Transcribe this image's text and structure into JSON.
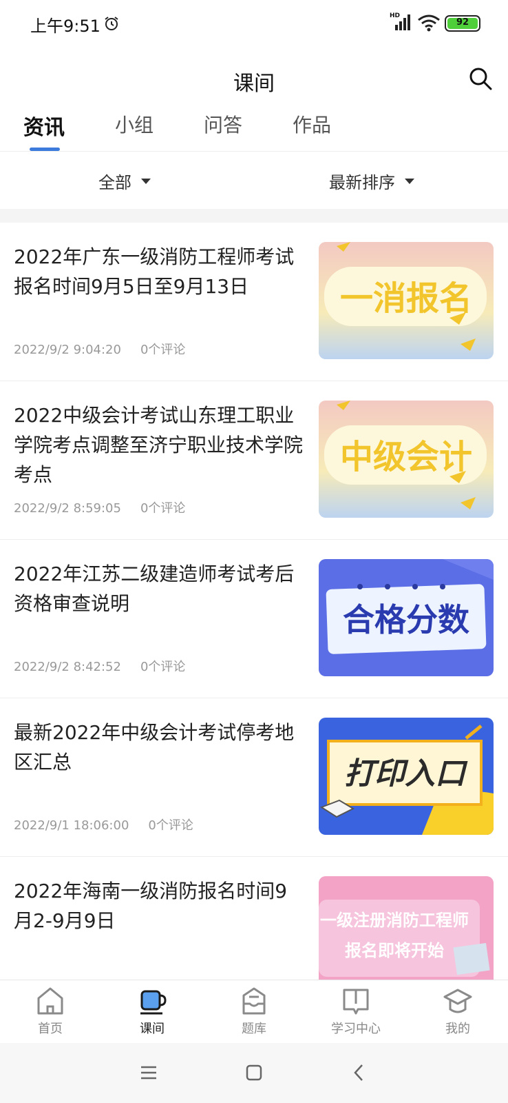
{
  "status_bar": {
    "time": "上午9:51",
    "network": "HD",
    "battery": "92"
  },
  "header": {
    "title": "课间"
  },
  "tabs": [
    {
      "label": "资讯",
      "active": true
    },
    {
      "label": "小组",
      "active": false
    },
    {
      "label": "问答",
      "active": false
    },
    {
      "label": "作品",
      "active": false
    }
  ],
  "filters": {
    "category": "全部",
    "sort": "最新排序"
  },
  "articles": [
    {
      "title": "2022年广东一级消防工程师考试报名时间9月5日至9月13日",
      "date": "2022/9/2 9:04:20",
      "comments": "0个评论",
      "thumb_text": "一消报名"
    },
    {
      "title": "2022中级会计考试山东理工职业学院考点调整至济宁职业技术学院考点",
      "date": "2022/9/2 8:59:05",
      "comments": "0个评论",
      "thumb_text": "中级会计"
    },
    {
      "title": "2022年江苏二级建造师考试考后资格审查说明",
      "date": "2022/9/2 8:42:52",
      "comments": "0个评论",
      "thumb_text": "合格分数"
    },
    {
      "title": "最新2022年中级会计考试停考地区汇总",
      "date": "2022/9/1 18:06:00",
      "comments": "0个评论",
      "thumb_text": "打印入口"
    },
    {
      "title": "2022年海南一级消防报名时间9月2-9月9日",
      "date": "",
      "comments": "",
      "thumb_text_line1": "一级注册消防工程师",
      "thumb_text_line2": "报名即将开始"
    }
  ],
  "bottom_nav": [
    {
      "label": "首页",
      "icon": "home-icon"
    },
    {
      "label": "课间",
      "icon": "cup-icon",
      "active": true
    },
    {
      "label": "题库",
      "icon": "inbox-icon"
    },
    {
      "label": "学习中心",
      "icon": "book-icon"
    },
    {
      "label": "我的",
      "icon": "graduation-cap-icon"
    }
  ],
  "colors": {
    "accent": "#3c7bdc",
    "text_primary": "#222222",
    "text_meta": "#999999"
  }
}
